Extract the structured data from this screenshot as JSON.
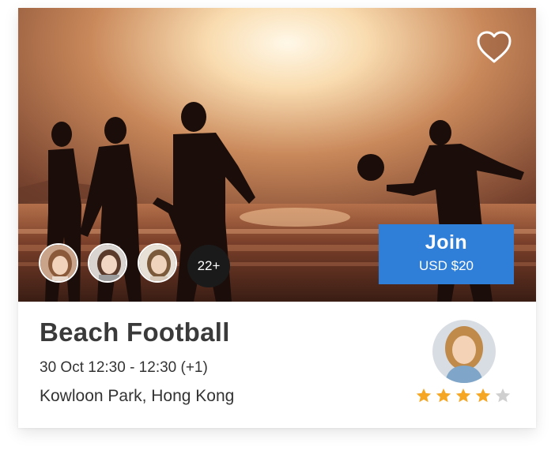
{
  "event": {
    "title": "Beach Football",
    "datetime": "30 Oct 12:30 - 12:30 (+1)",
    "location": "Kowloon Park, Hong Kong",
    "attendees_more": "22+",
    "join": {
      "label": "Join",
      "price": "USD $20"
    },
    "favorite_icon": "heart-icon",
    "host": {
      "rating": 4,
      "max_rating": 5
    }
  },
  "colors": {
    "accent": "#2f7ed8",
    "star_filled": "#f5a623",
    "star_empty": "#cfcfcf",
    "title_text": "#3a3a3a"
  }
}
